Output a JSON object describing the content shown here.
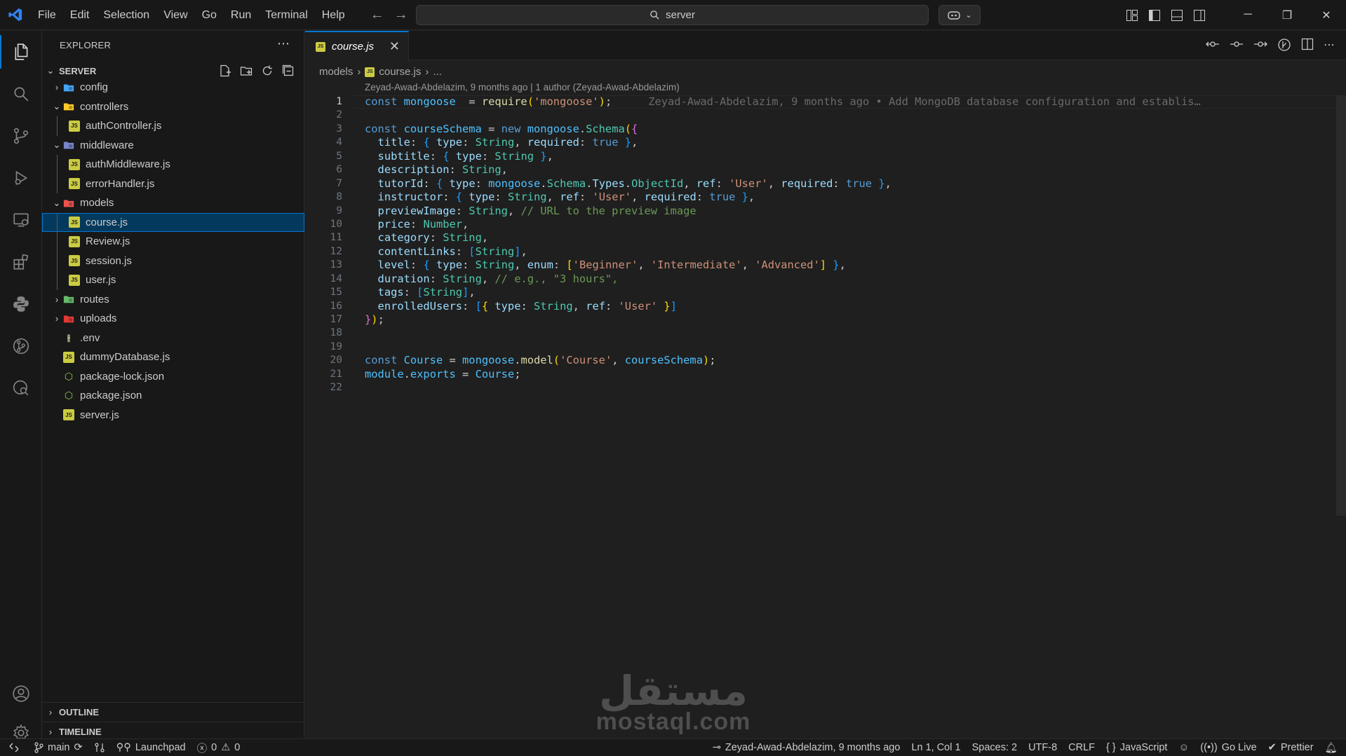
{
  "titlebar": {
    "menu": [
      "File",
      "Edit",
      "Selection",
      "View",
      "Go",
      "Run",
      "Terminal",
      "Help"
    ],
    "search_text": "server"
  },
  "explorer": {
    "title": "EXPLORER",
    "root": "SERVER",
    "tree": [
      {
        "label": "config",
        "type": "folder",
        "depth": 0,
        "open": false,
        "color": "#42a5f5"
      },
      {
        "label": "controllers",
        "type": "folder",
        "depth": 0,
        "open": true,
        "color": "#ffca28"
      },
      {
        "label": "authController.js",
        "type": "js",
        "depth": 1
      },
      {
        "label": "middleware",
        "type": "folder",
        "depth": 0,
        "open": true,
        "color": "#7986cb"
      },
      {
        "label": "authMiddleware.js",
        "type": "js",
        "depth": 1
      },
      {
        "label": "errorHandler.js",
        "type": "js",
        "depth": 1
      },
      {
        "label": "models",
        "type": "folder",
        "depth": 0,
        "open": true,
        "color": "#ef5350"
      },
      {
        "label": "course.js",
        "type": "js",
        "depth": 1,
        "selected": true
      },
      {
        "label": "Review.js",
        "type": "js",
        "depth": 1
      },
      {
        "label": "session.js",
        "type": "js",
        "depth": 1
      },
      {
        "label": "user.js",
        "type": "js",
        "depth": 1
      },
      {
        "label": "routes",
        "type": "folder",
        "depth": 0,
        "open": false,
        "color": "#66bb6a"
      },
      {
        "label": "uploads",
        "type": "folder",
        "depth": 0,
        "open": false,
        "color": "#e53935"
      },
      {
        "label": ".env",
        "type": "env",
        "depth": 0
      },
      {
        "label": "dummyDatabase.js",
        "type": "js",
        "depth": 0
      },
      {
        "label": "package-lock.json",
        "type": "json",
        "depth": 0
      },
      {
        "label": "package.json",
        "type": "json",
        "depth": 0
      },
      {
        "label": "server.js",
        "type": "js",
        "depth": 0
      }
    ],
    "outline_label": "OUTLINE",
    "timeline_label": "TIMELINE"
  },
  "editor": {
    "tab_label": "course.js",
    "breadcrumb": [
      "models",
      "course.js",
      "..."
    ],
    "blame_header": "Zeyad-Awad-Abdelazim, 9 months ago | 1 author (Zeyad-Awad-Abdelazim)",
    "inline_blame": "Zeyad-Awad-Abdelazim, 9 months ago • Add MongoDB database configuration and establis…",
    "lines": [
      [
        [
          "kw",
          "const "
        ],
        [
          "var",
          "mongoose"
        ],
        [
          "",
          "  = "
        ],
        [
          "fn",
          "require"
        ],
        [
          "br1",
          "("
        ],
        [
          "str",
          "'mongoose'"
        ],
        [
          "br1",
          ")"
        ],
        [
          "",
          ";"
        ]
      ],
      [],
      [
        [
          "kw",
          "const "
        ],
        [
          "var",
          "courseSchema"
        ],
        [
          "",
          " = "
        ],
        [
          "kw",
          "new "
        ],
        [
          "var",
          "mongoose"
        ],
        [
          "",
          "."
        ],
        [
          "cls",
          "Schema"
        ],
        [
          "br1",
          "("
        ],
        [
          "br2",
          "{"
        ]
      ],
      [
        [
          "",
          "  "
        ],
        [
          "vr",
          "title"
        ],
        [
          "",
          ": "
        ],
        [
          "br3",
          "{ "
        ],
        [
          "vr",
          "type"
        ],
        [
          "",
          ": "
        ],
        [
          "cls",
          "String"
        ],
        [
          "",
          ", "
        ],
        [
          "vr",
          "required"
        ],
        [
          "",
          ": "
        ],
        [
          "kw",
          "true"
        ],
        [
          "br3",
          " }"
        ],
        [
          "",
          ","
        ]
      ],
      [
        [
          "",
          "  "
        ],
        [
          "vr",
          "subtitle"
        ],
        [
          "",
          ": "
        ],
        [
          "br3",
          "{ "
        ],
        [
          "vr",
          "type"
        ],
        [
          "",
          ": "
        ],
        [
          "cls",
          "String"
        ],
        [
          "br3",
          " }"
        ],
        [
          "",
          ","
        ]
      ],
      [
        [
          "",
          "  "
        ],
        [
          "vr",
          "description"
        ],
        [
          "",
          ": "
        ],
        [
          "cls",
          "String"
        ],
        [
          "",
          ","
        ]
      ],
      [
        [
          "",
          "  "
        ],
        [
          "vr",
          "tutorId"
        ],
        [
          "",
          ": "
        ],
        [
          "br3",
          "{ "
        ],
        [
          "vr",
          "type"
        ],
        [
          "",
          ": "
        ],
        [
          "var",
          "mongoose"
        ],
        [
          "",
          "."
        ],
        [
          "cls",
          "Schema"
        ],
        [
          "",
          "."
        ],
        [
          "vr",
          "Types"
        ],
        [
          "",
          "."
        ],
        [
          "cls",
          "ObjectId"
        ],
        [
          "",
          ", "
        ],
        [
          "vr",
          "ref"
        ],
        [
          "",
          ": "
        ],
        [
          "str",
          "'User'"
        ],
        [
          "",
          ", "
        ],
        [
          "vr",
          "required"
        ],
        [
          "",
          ": "
        ],
        [
          "kw",
          "true"
        ],
        [
          "br3",
          " }"
        ],
        [
          "",
          ","
        ]
      ],
      [
        [
          "",
          "  "
        ],
        [
          "vr",
          "instructor"
        ],
        [
          "",
          ": "
        ],
        [
          "br3",
          "{ "
        ],
        [
          "vr",
          "type"
        ],
        [
          "",
          ": "
        ],
        [
          "cls",
          "String"
        ],
        [
          "",
          ", "
        ],
        [
          "vr",
          "ref"
        ],
        [
          "",
          ": "
        ],
        [
          "str",
          "'User'"
        ],
        [
          "",
          ", "
        ],
        [
          "vr",
          "required"
        ],
        [
          "",
          ": "
        ],
        [
          "kw",
          "true"
        ],
        [
          "br3",
          " }"
        ],
        [
          "",
          ","
        ]
      ],
      [
        [
          "",
          "  "
        ],
        [
          "vr",
          "previewImage"
        ],
        [
          "",
          ": "
        ],
        [
          "cls",
          "String"
        ],
        [
          "",
          ", "
        ],
        [
          "cm",
          "// URL to the preview image"
        ]
      ],
      [
        [
          "",
          "  "
        ],
        [
          "vr",
          "price"
        ],
        [
          "",
          ": "
        ],
        [
          "cls",
          "Number"
        ],
        [
          "",
          ","
        ]
      ],
      [
        [
          "",
          "  "
        ],
        [
          "vr",
          "category"
        ],
        [
          "",
          ": "
        ],
        [
          "cls",
          "String"
        ],
        [
          "",
          ","
        ]
      ],
      [
        [
          "",
          "  "
        ],
        [
          "vr",
          "contentLinks"
        ],
        [
          "",
          ": "
        ],
        [
          "br3",
          "["
        ],
        [
          "cls",
          "String"
        ],
        [
          "br3",
          "]"
        ],
        [
          "",
          ","
        ]
      ],
      [
        [
          "",
          "  "
        ],
        [
          "vr",
          "level"
        ],
        [
          "",
          ": "
        ],
        [
          "br3",
          "{ "
        ],
        [
          "vr",
          "type"
        ],
        [
          "",
          ": "
        ],
        [
          "cls",
          "String"
        ],
        [
          "",
          ", "
        ],
        [
          "vr",
          "enum"
        ],
        [
          "",
          ": "
        ],
        [
          "br1",
          "["
        ],
        [
          "str",
          "'Beginner'"
        ],
        [
          "",
          ", "
        ],
        [
          "str",
          "'Intermediate'"
        ],
        [
          "",
          ", "
        ],
        [
          "str",
          "'Advanced'"
        ],
        [
          "br1",
          "]"
        ],
        [
          "br3",
          " }"
        ],
        [
          "",
          ","
        ]
      ],
      [
        [
          "",
          "  "
        ],
        [
          "vr",
          "duration"
        ],
        [
          "",
          ": "
        ],
        [
          "cls",
          "String"
        ],
        [
          "",
          ", "
        ],
        [
          "cm",
          "// e.g., \"3 hours\","
        ]
      ],
      [
        [
          "",
          "  "
        ],
        [
          "vr",
          "tags"
        ],
        [
          "",
          ": "
        ],
        [
          "br3",
          "["
        ],
        [
          "cls",
          "String"
        ],
        [
          "br3",
          "]"
        ],
        [
          "",
          ","
        ]
      ],
      [
        [
          "",
          "  "
        ],
        [
          "vr",
          "enrolledUsers"
        ],
        [
          "",
          ": "
        ],
        [
          "br3",
          "["
        ],
        [
          "br1",
          "{ "
        ],
        [
          "vr",
          "type"
        ],
        [
          "",
          ": "
        ],
        [
          "cls",
          "String"
        ],
        [
          "",
          ", "
        ],
        [
          "vr",
          "ref"
        ],
        [
          "",
          ": "
        ],
        [
          "str",
          "'User'"
        ],
        [
          "br1",
          " }"
        ],
        [
          "br3",
          "]"
        ]
      ],
      [
        [
          "br2",
          "}"
        ],
        [
          "br1",
          ")"
        ],
        [
          "",
          ";"
        ]
      ],
      [],
      [],
      [
        [
          "kw",
          "const "
        ],
        [
          "var",
          "Course"
        ],
        [
          "",
          " = "
        ],
        [
          "var",
          "mongoose"
        ],
        [
          "",
          "."
        ],
        [
          "fn",
          "model"
        ],
        [
          "br1",
          "("
        ],
        [
          "str",
          "'Course'"
        ],
        [
          "",
          ", "
        ],
        [
          "var",
          "courseSchema"
        ],
        [
          "br1",
          ")"
        ],
        [
          "",
          ";"
        ]
      ],
      [
        [
          "var",
          "module"
        ],
        [
          "",
          "."
        ],
        [
          "var",
          "exports"
        ],
        [
          "",
          " = "
        ],
        [
          "var",
          "Course"
        ],
        [
          "",
          ";"
        ]
      ],
      []
    ]
  },
  "watermark": {
    "arabic": "مستقل",
    "latin": "mostaql.com"
  },
  "statusbar": {
    "branch": "main",
    "launchpad": "Launchpad",
    "errors": "0",
    "warnings": "0",
    "blame": "Zeyad-Awad-Abdelazim, 9 months ago",
    "position": "Ln 1, Col 1",
    "spaces": "Spaces: 2",
    "encoding": "UTF-8",
    "eol": "CRLF",
    "language": "JavaScript",
    "golive": "Go Live",
    "prettier": "Prettier"
  },
  "colors": {
    "accent": "#0078d4",
    "selection": "#04395e",
    "js_icon": "#cbcb41"
  }
}
